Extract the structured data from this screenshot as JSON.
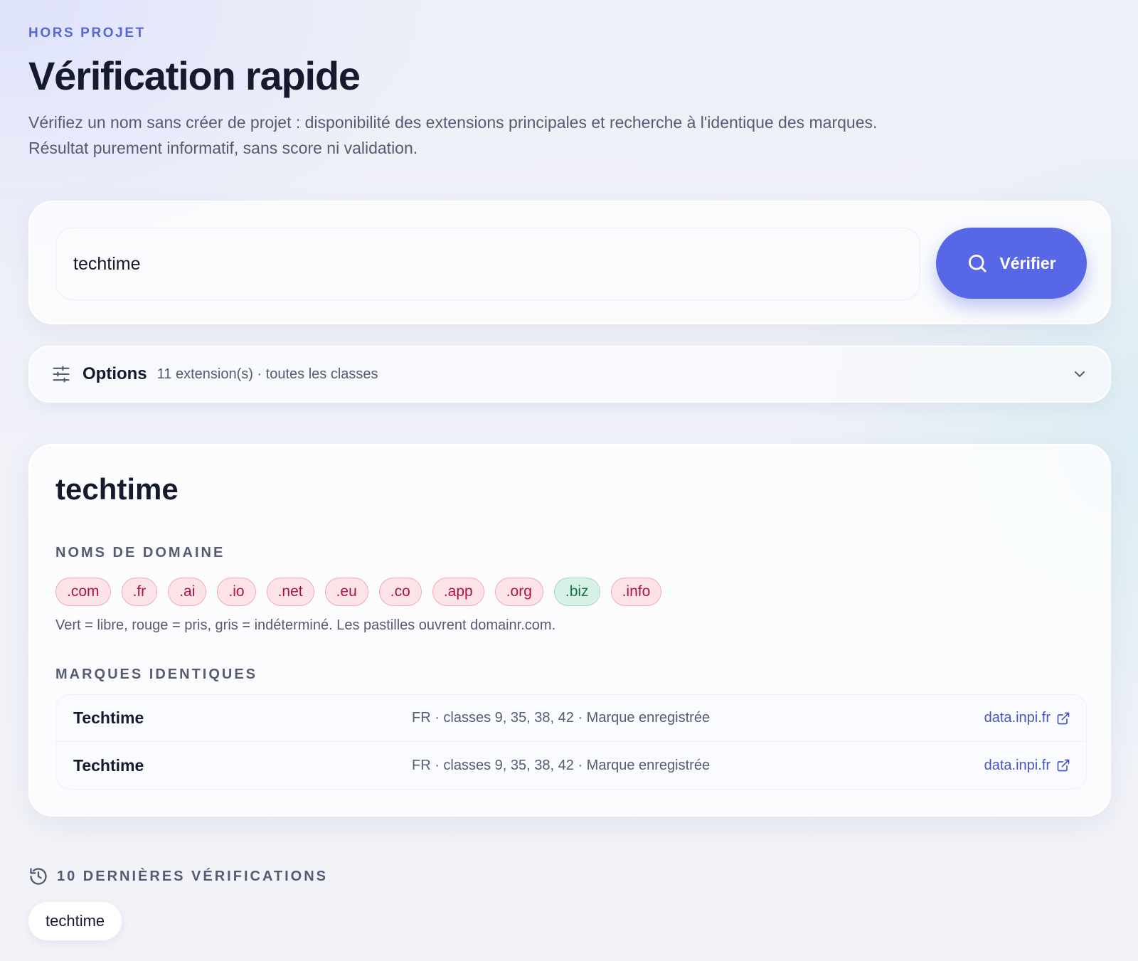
{
  "header": {
    "eyebrow": "HORS PROJET",
    "title": "Vérification rapide",
    "subtitle": "Vérifiez un nom sans créer de projet : disponibilité des extensions principales et recherche à l'identique des marques. Résultat purement informatif, sans score ni validation."
  },
  "search": {
    "value": "techtime",
    "button_label": "Vérifier",
    "button_icon": "search-icon"
  },
  "options": {
    "label": "Options",
    "summary": "11 extension(s) · toutes les classes",
    "icon": "sliders-icon",
    "toggle_icon": "chevron-down-icon"
  },
  "result": {
    "name": "techtime",
    "domains_label": "NOMS DE DOMAINE",
    "domains": [
      {
        "ext": ".com",
        "status": "taken"
      },
      {
        "ext": ".fr",
        "status": "taken"
      },
      {
        "ext": ".ai",
        "status": "taken"
      },
      {
        "ext": ".io",
        "status": "taken"
      },
      {
        "ext": ".net",
        "status": "taken"
      },
      {
        "ext": ".eu",
        "status": "taken"
      },
      {
        "ext": ".co",
        "status": "taken"
      },
      {
        "ext": ".app",
        "status": "taken"
      },
      {
        "ext": ".org",
        "status": "taken"
      },
      {
        "ext": ".biz",
        "status": "free"
      },
      {
        "ext": ".info",
        "status": "taken"
      }
    ],
    "legend": "Vert = libre, rouge = pris, gris = indéterminé. Les pastilles ouvrent domainr.com.",
    "marks_label": "MARQUES IDENTIQUES",
    "marks": [
      {
        "name": "Techtime",
        "meta": "FR · classes 9, 35, 38, 42 · Marque enregistrée",
        "link": "data.inpi.fr"
      },
      {
        "name": "Techtime",
        "meta": "FR · classes 9, 35, 38, 42 · Marque enregistrée",
        "link": "data.inpi.fr"
      }
    ]
  },
  "history": {
    "label": "10 DERNIÈRES VÉRIFICATIONS",
    "icon": "history-icon",
    "items": [
      "techtime"
    ]
  },
  "colors": {
    "accent": "#5867e6",
    "taken": "#b3123c",
    "free": "#10754b",
    "link": "#4655c2"
  }
}
